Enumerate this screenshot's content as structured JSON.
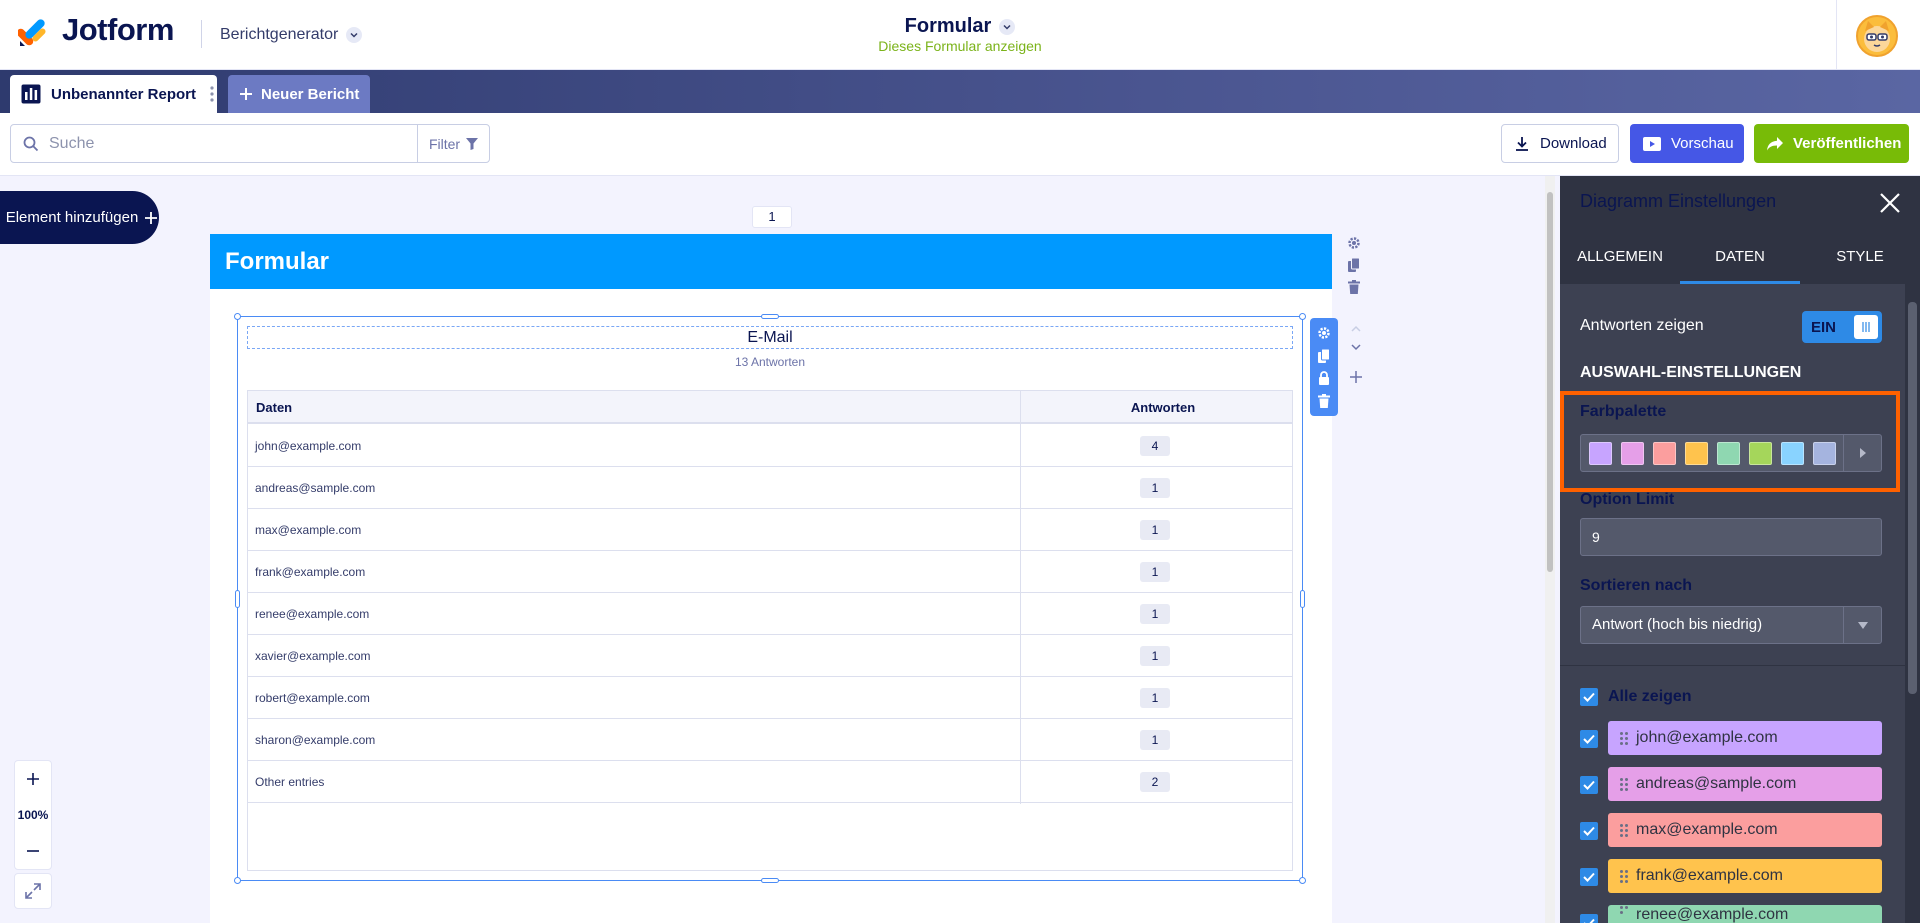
{
  "header": {
    "logo_text": "Jotform",
    "app_selector": "Berichtgenerator",
    "form_title": "Formular",
    "form_view_link": "Dieses Formular anzeigen"
  },
  "tabs": {
    "active_tab": "Unbenannter Report",
    "new_tab": "Neuer Bericht"
  },
  "toolbar": {
    "search_placeholder": "Suche",
    "filter_label": "Filter",
    "download_label": "Download",
    "preview_label": "Vorschau",
    "publish_label": "Veröffentlichen"
  },
  "canvas": {
    "add_element_label": "Element hinzufügen",
    "page_number": "1",
    "page_header": "Formular",
    "zoom_level": "100%"
  },
  "widget": {
    "title": "E-Mail",
    "subtitle": "13 Antworten",
    "columns": [
      "Daten",
      "Antworten"
    ],
    "rows": [
      {
        "label": "john@example.com",
        "count": "4"
      },
      {
        "label": "andreas@sample.com",
        "count": "1"
      },
      {
        "label": "max@example.com",
        "count": "1"
      },
      {
        "label": "frank@example.com",
        "count": "1"
      },
      {
        "label": "renee@example.com",
        "count": "1"
      },
      {
        "label": "xavier@example.com",
        "count": "1"
      },
      {
        "label": "robert@example.com",
        "count": "1"
      },
      {
        "label": "sharon@example.com",
        "count": "1"
      },
      {
        "label": "Other entries",
        "count": "2"
      }
    ]
  },
  "panel": {
    "title": "Diagramm Einstellungen",
    "tabs": [
      "ALLGEMEIN",
      "DATEN",
      "STYLE"
    ],
    "active_tab": "DATEN",
    "show_answers_label": "Antworten zeigen",
    "show_answers_toggle": "EIN",
    "selection_section": "AUSWAHL-EINSTELLUNGEN",
    "palette_label": "Farbpalette",
    "palette_colors": [
      "#c7a4ff",
      "#e59fe8",
      "#fb9e9e",
      "#ffc34d",
      "#8fd7b1",
      "#a5d65b",
      "#89d3ff",
      "#a5b4df"
    ],
    "option_limit_label": "Option Limit",
    "option_limit_value": "9",
    "sort_label": "Sortieren nach",
    "sort_value": "Antwort (hoch bis niedrig)",
    "show_all_label": "Alle zeigen",
    "items": [
      {
        "label": "john@example.com",
        "color": "#c7a4ff"
      },
      {
        "label": "andreas@sample.com",
        "color": "#e59fe8"
      },
      {
        "label": "max@example.com",
        "color": "#fb9e9e"
      },
      {
        "label": "frank@example.com",
        "color": "#ffc34d"
      },
      {
        "label": "renee@example.com",
        "color": "#8fd7b1"
      }
    ]
  },
  "colors": {
    "accent_blue": "#0099ff",
    "publish_green": "#78bb07",
    "preview_blue": "#4557e6",
    "highlight_orange": "#ff6100",
    "panel_bg": "#3d4152"
  }
}
